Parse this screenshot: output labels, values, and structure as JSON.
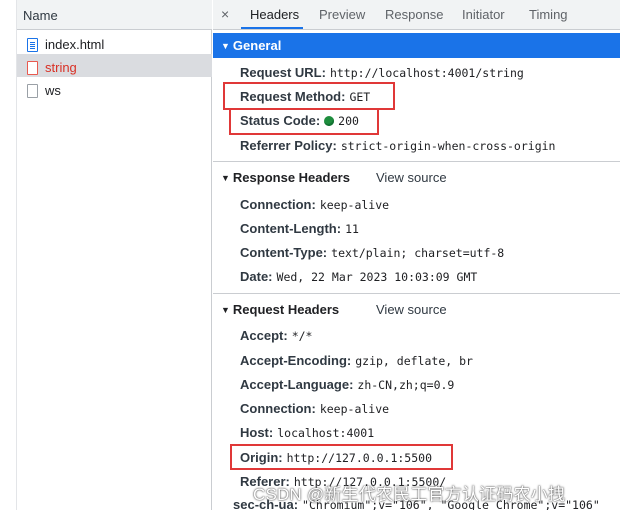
{
  "network": {
    "name_header": "Name",
    "requests": [
      {
        "label": "index.html",
        "icon": "document-icon"
      },
      {
        "label": "string",
        "icon": "file-error-icon"
      },
      {
        "label": "ws",
        "icon": "file-icon"
      }
    ]
  },
  "details": {
    "close_symbol": "×",
    "tabs": [
      "Headers",
      "Preview",
      "Response",
      "Initiator",
      "Timing"
    ],
    "general": {
      "title": "General",
      "rows": [
        {
          "key": "Request URL:",
          "value": "http://localhost:4001/string"
        },
        {
          "key": "Request Method:",
          "value": "GET"
        },
        {
          "key": "Status Code:",
          "value": "200"
        },
        {
          "key": "Referrer Policy:",
          "value": "strict-origin-when-cross-origin"
        }
      ]
    },
    "response_headers": {
      "title": "Response Headers",
      "view_source": "View source",
      "rows": [
        {
          "key": "Connection:",
          "value": "keep-alive"
        },
        {
          "key": "Content-Length:",
          "value": "11"
        },
        {
          "key": "Content-Type:",
          "value": "text/plain; charset=utf-8"
        },
        {
          "key": "Date:",
          "value": "Wed, 22 Mar 2023 10:03:09 GMT"
        }
      ]
    },
    "request_headers": {
      "title": "Request Headers",
      "view_source": "View source",
      "rows": [
        {
          "key": "Accept:",
          "value": "*/*"
        },
        {
          "key": "Accept-Encoding:",
          "value": "gzip, deflate, br"
        },
        {
          "key": "Accept-Language:",
          "value": "zh-CN,zh;q=0.9"
        },
        {
          "key": "Connection:",
          "value": "keep-alive"
        },
        {
          "key": "Host:",
          "value": "localhost:4001"
        },
        {
          "key": "Origin:",
          "value": "http://127.0.0.1:5500"
        },
        {
          "key": "Referer:",
          "value": "http://127.0.0.1:5500/"
        },
        {
          "key": "sec-ch-ua:",
          "value": "\"Chromium\";v=\"106\", \"Google Chrome\";v=\"106\""
        }
      ]
    }
  },
  "status_color": "#1e8e3e",
  "accent_color": "#1a73e8",
  "highlight_color": "#e03838",
  "watermark": "CSDN @新生代农民工官方认证码农小拽"
}
